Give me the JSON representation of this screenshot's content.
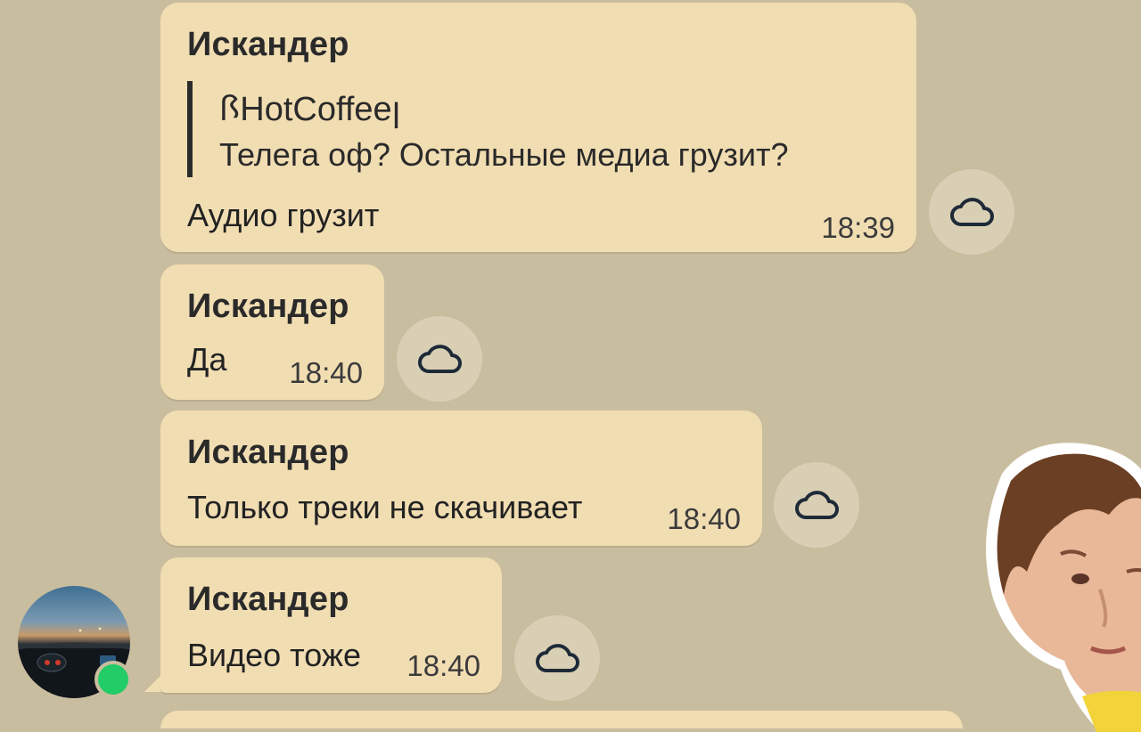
{
  "messages": [
    {
      "sender": "Искандер",
      "reply": {
        "name": "ꟗHotCoffeeꞁ",
        "text": "Телега оф? Остальные медиа грузит?"
      },
      "text": "Аудио грузит",
      "time": "18:39"
    },
    {
      "sender": "Искандер",
      "text": "Да",
      "time": "18:40"
    },
    {
      "sender": "Искандер",
      "text": "Только треки не скачивает",
      "time": "18:40"
    },
    {
      "sender": "Искандер",
      "text": "Видео тоже",
      "time": "18:40"
    }
  ],
  "icons": {
    "action": "cloud-icon",
    "status": "online-dot"
  },
  "colors": {
    "background": "#c9bd9f",
    "bubble": "#f1ddb2",
    "online": "#22cc66"
  }
}
